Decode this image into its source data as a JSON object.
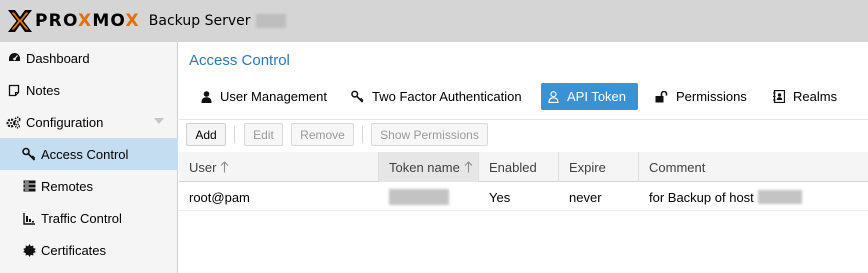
{
  "header": {
    "logo_pro_prefix": "PRO",
    "logo_x": "X",
    "logo_mox": "MO",
    "logo_x2": "X",
    "product": "Backup Server"
  },
  "sidebar": {
    "items": [
      {
        "label": "Dashboard",
        "icon": "tachometer-icon"
      },
      {
        "label": "Notes",
        "icon": "note-icon"
      },
      {
        "label": "Configuration",
        "icon": "gears-icon"
      },
      {
        "label": "Access Control",
        "icon": "key-icon",
        "active": true
      },
      {
        "label": "Remotes",
        "icon": "server-icon"
      },
      {
        "label": "Traffic Control",
        "icon": "signal-icon"
      },
      {
        "label": "Certificates",
        "icon": "certificate-icon"
      }
    ]
  },
  "main": {
    "title": "Access Control",
    "tabs": [
      {
        "label": "User Management",
        "icon": "user-icon"
      },
      {
        "label": "Two Factor Authentication",
        "icon": "key-icon"
      },
      {
        "label": "API Token",
        "icon": "user-outline-icon",
        "active": true
      },
      {
        "label": "Permissions",
        "icon": "unlock-icon"
      },
      {
        "label": "Realms",
        "icon": "address-book-icon"
      }
    ],
    "toolbar": {
      "add": "Add",
      "edit": "Edit",
      "remove": "Remove",
      "show_permissions": "Show Permissions"
    },
    "grid": {
      "columns": [
        "User",
        "Token name",
        "Enabled",
        "Expire",
        "Comment"
      ],
      "rows": [
        {
          "user": "root@pam",
          "token": "",
          "enabled": "Yes",
          "expire": "never",
          "comment": "for Backup of host"
        }
      ]
    }
  },
  "colors": {
    "accent": "#3892d4",
    "title_blue": "#2d78b7",
    "brand_orange": "#e57000",
    "active_nav": "#c4ddf1"
  }
}
